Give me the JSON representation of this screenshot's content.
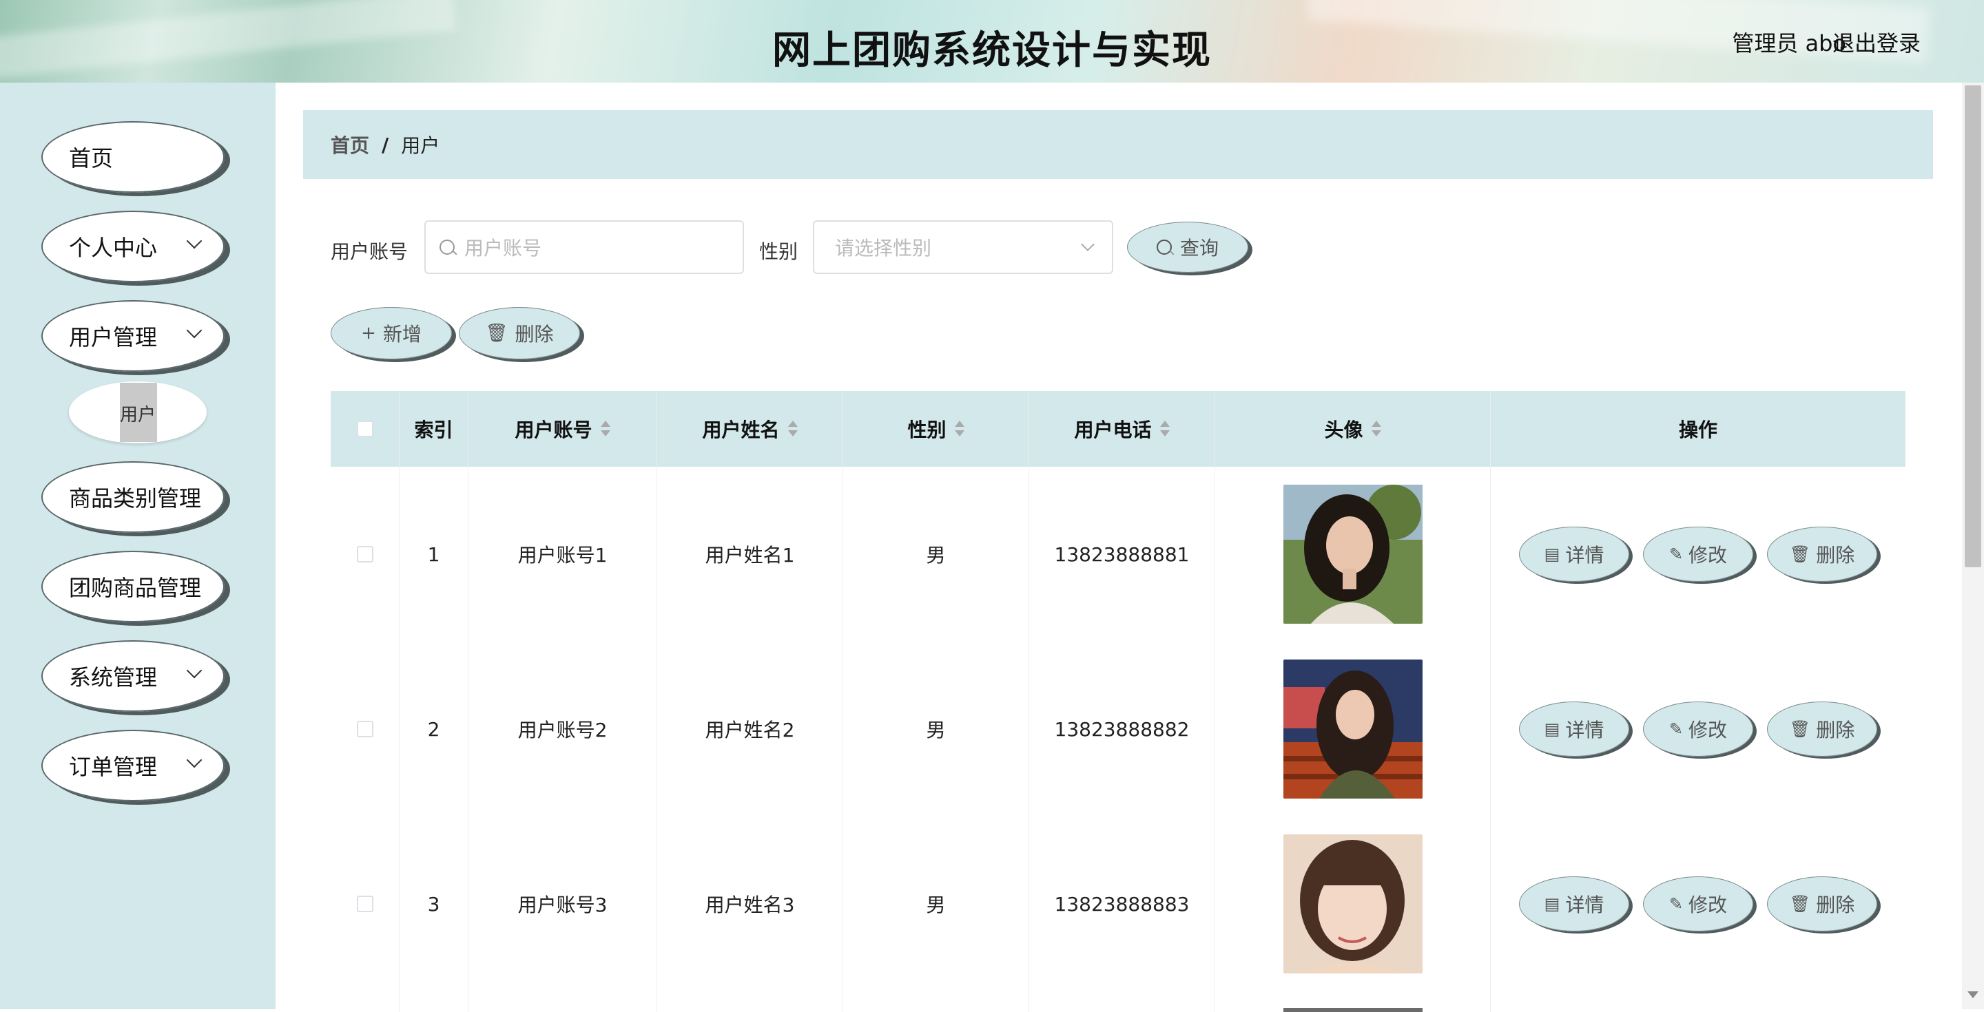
{
  "header": {
    "title": "网上团购系统设计与实现",
    "user": "管理员 abo",
    "logout": "退出登录"
  },
  "sidebar": {
    "items": [
      {
        "label": "首页"
      },
      {
        "label": "个人中心"
      },
      {
        "label": "用户管理"
      },
      {
        "label": "商品类别管理"
      },
      {
        "label": "团购商品管理"
      },
      {
        "label": "系统管理"
      },
      {
        "label": "订单管理"
      }
    ],
    "sub_item": "用户"
  },
  "breadcrumb": {
    "home": "首页",
    "separator": "/",
    "current": "用户"
  },
  "search": {
    "account_label": "用户账号",
    "account_placeholder": "用户账号",
    "gender_label": "性别",
    "gender_placeholder": "请选择性别",
    "query_button": "查询"
  },
  "toolbar": {
    "add_button": "新增",
    "delete_button": "删除"
  },
  "table": {
    "columns": [
      "索引",
      "用户账号",
      "用户姓名",
      "性别",
      "用户电话",
      "头像",
      "操作"
    ],
    "actions": {
      "detail": "详情",
      "edit": "修改",
      "delete": "删除"
    },
    "rows": [
      {
        "index": "1",
        "account": "用户账号1",
        "name": "用户姓名1",
        "gender": "男",
        "phone": "13823888881"
      },
      {
        "index": "2",
        "account": "用户账号2",
        "name": "用户姓名2",
        "gender": "男",
        "phone": "13823888882"
      },
      {
        "index": "3",
        "account": "用户账号3",
        "name": "用户姓名3",
        "gender": "男",
        "phone": "13823888883"
      }
    ]
  },
  "colors": {
    "accent": "#d3e8ea",
    "shadow": "#4f5b5c"
  },
  "icons": [
    "search-icon",
    "plus-icon",
    "trash-icon",
    "document-icon",
    "edit-icon",
    "chevron-down-icon",
    "sort-icon"
  ]
}
